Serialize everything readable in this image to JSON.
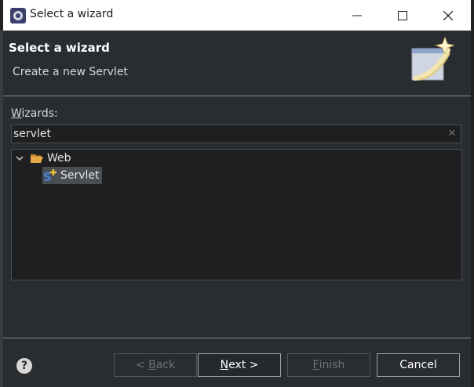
{
  "window": {
    "title": "Select a wizard",
    "controls": {
      "minimize_icon": "minimize-icon",
      "maximize_icon": "maximize-icon",
      "close_icon": "close-icon"
    }
  },
  "header": {
    "title": "Select a wizard",
    "description": "Create a new Servlet"
  },
  "wizards": {
    "label_mnemonic": "W",
    "label_rest": "izards:",
    "filter_value": "servlet"
  },
  "tree": {
    "items": [
      {
        "label": "Web",
        "icon": "folder-open-icon",
        "expanded": true
      },
      {
        "label": "Servlet",
        "icon": "servlet-icon",
        "selected": true
      }
    ]
  },
  "buttons": {
    "back": {
      "pre": "< ",
      "mnemonic": "B",
      "rest": "ack"
    },
    "next": {
      "mnemonic": "N",
      "rest": "ext >"
    },
    "finish": {
      "mnemonic": "F",
      "rest": "inish"
    },
    "cancel": "Cancel"
  },
  "help": {
    "glyph": "?"
  },
  "colors": {
    "dialog_bg": "#2a2d30",
    "field_bg": "#1e1f21",
    "selection": "#4a4d52",
    "folder": "#e8a84a",
    "servlet_s": "#4a7fd6",
    "servlet_plus": "#f0c43a"
  }
}
